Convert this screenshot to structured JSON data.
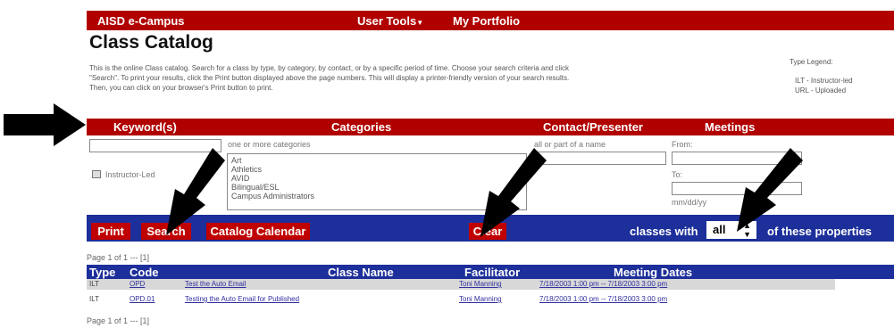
{
  "topnav": {
    "brand": "AISD e-Campus",
    "user_tools": "User Tools",
    "portfolio": "My Portfolio"
  },
  "page_title": "Class Catalog",
  "intro": {
    "line1": "This is the online Class catalog. Search for a class by type, by category, by contact, or by a specific period of time. Choose your search criteria and click",
    "line2": "\"Search\". To print your results, click the Print button displayed above the page numbers. This will display a printer-friendly version of your search results.",
    "line3": "Then, you can click on your browser's Print button to print."
  },
  "type_legend": {
    "title": "Type Legend:",
    "items": [
      "ILT - Instructor-led",
      "URL - Uploaded"
    ]
  },
  "search_headers": {
    "keywords": "Keyword(s)",
    "categories": "Categories",
    "contact": "Contact/Presenter",
    "meetings": "Meetings"
  },
  "categories_hint": "one or more categories",
  "categories_list": [
    "Art",
    "Athletics",
    "AVID",
    "Bilingual/ESL",
    "Campus Administrators"
  ],
  "contact_hint": "all or part of a name",
  "meetings": {
    "from": "From:",
    "to": "To:",
    "date_hint": "mm/dd/yy"
  },
  "instructor_led_label": "Instructor-Led",
  "toolbar": {
    "print": "Print",
    "search": "Search",
    "calendar": "Catalog Calendar",
    "clear": "Clear",
    "classes_with": "classes with",
    "match_value": "all",
    "of_these": "of these properties"
  },
  "pager_top": "Page 1 of 1 --- [1]",
  "pager_bottom": "Page 1 of 1 --- [1]",
  "table": {
    "headers": {
      "type": "Type",
      "code": "Code",
      "name": "Class Name",
      "facilitator": "Facilitator",
      "dates": "Meeting Dates"
    },
    "rows": [
      {
        "type": "ILT",
        "code": "OPD",
        "name": "Test the Auto Email",
        "facilitator": "Toni Manning",
        "dates": "7/18/2003 1:00 pm -- 7/18/2003 3:00 pm"
      },
      {
        "type": "ILT",
        "code": "OPD.01",
        "name": "Testing the Auto Email for Published",
        "facilitator": "Toni Manning",
        "dates": "7/18/2003 1:00 pm -- 7/18/2003 3:00 pm"
      }
    ]
  },
  "colors": {
    "nav_red": "#b00000",
    "toolbar_blue": "#1d2f9a",
    "button_red": "#c00000",
    "arrow": "#000000"
  }
}
